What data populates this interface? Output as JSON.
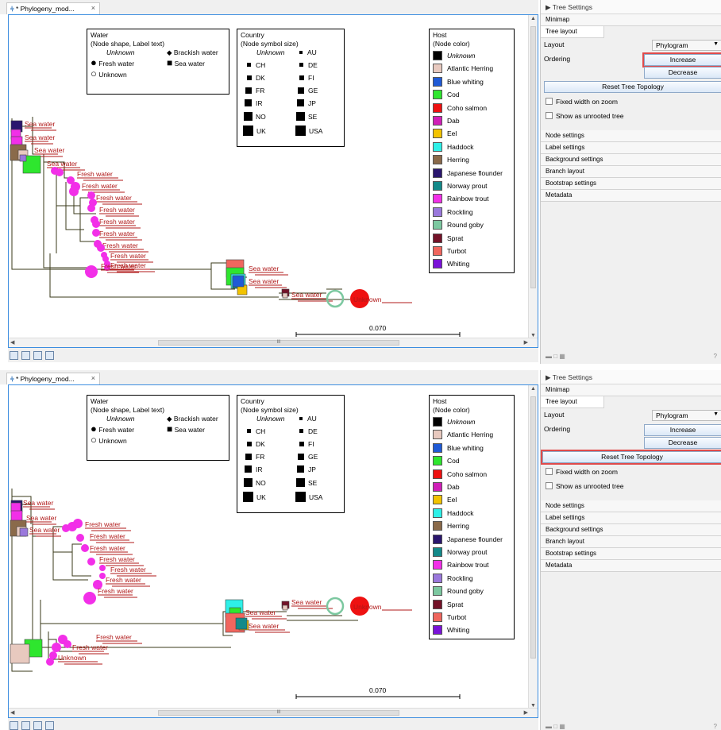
{
  "editor": {
    "tab_label": "* Phylogeny_mod...",
    "tab_icon": "tree-icon",
    "close_glyph": "×"
  },
  "side": {
    "title": "Tree Settings",
    "sections_top": [
      "Minimap",
      "Tree layout"
    ],
    "layout_label": "Layout",
    "layout_value": "Phylogram",
    "ordering_label": "Ordering",
    "increase_label": "Increase",
    "decrease_label": "Decrease",
    "reset_label": "Reset Tree Topology",
    "fixed_width_label": "Fixed width on zoom",
    "unrooted_label": "Show as unrooted tree",
    "sections_bottom": [
      "Node settings",
      "Label settings",
      "Background settings",
      "Branch layout",
      "Bootstrap settings",
      "Metadata"
    ],
    "help": "?",
    "highlight_color": "#e04b4b"
  },
  "legend": {
    "water": {
      "title1": "Water",
      "title2": "(Node shape, Label text)",
      "unknown": "Unknown",
      "brackish": "Brackish water",
      "fresh": "Fresh water",
      "sea": "Sea water",
      "unknown2": "Unknown"
    },
    "country": {
      "title1": "Country",
      "title2": "(Node symbol size)",
      "unknown": "Unknown",
      "items": [
        "AU",
        "CH",
        "DE",
        "DK",
        "FI",
        "FR",
        "GE",
        "IR",
        "JP",
        "NO",
        "SE",
        "UK",
        "USA"
      ]
    },
    "host": {
      "title1": "Host",
      "title2": "(Node color)",
      "items": [
        {
          "label": "Unknown",
          "color": "#000000"
        },
        {
          "label": "Atlantic Herring",
          "color": "#e8c9bf"
        },
        {
          "label": "Blue whiting",
          "color": "#1f5ad6"
        },
        {
          "label": "Cod",
          "color": "#2ee62e"
        },
        {
          "label": "Coho salmon",
          "color": "#ee1111"
        },
        {
          "label": "Dab",
          "color": "#d01fb8"
        },
        {
          "label": "Eel",
          "color": "#f2c300"
        },
        {
          "label": "Haddock",
          "color": "#2ef0e8"
        },
        {
          "label": "Herring",
          "color": "#8a6a4a"
        },
        {
          "label": "Japanese flounder",
          "color": "#2a166e"
        },
        {
          "label": "Norway prout",
          "color": "#138a8a"
        },
        {
          "label": "Rainbow trout",
          "color": "#f22fe8"
        },
        {
          "label": "Rockling",
          "color": "#9a78dc"
        },
        {
          "label": "Round goby",
          "color": "#7cc8a0"
        },
        {
          "label": "Sprat",
          "color": "#741228"
        },
        {
          "label": "Turbot",
          "color": "#f0665e"
        },
        {
          "label": "Whiting",
          "color": "#7a12d8"
        }
      ]
    }
  },
  "tree": {
    "sea_label": "Sea water",
    "fresh_label": "Fresh water",
    "unknown_label": "Unknown",
    "label_color": "#b01818",
    "branch_color": "#3a3a1a",
    "scale_value": "0.070"
  },
  "scroll": {
    "h_thumb_glyph": "III"
  }
}
